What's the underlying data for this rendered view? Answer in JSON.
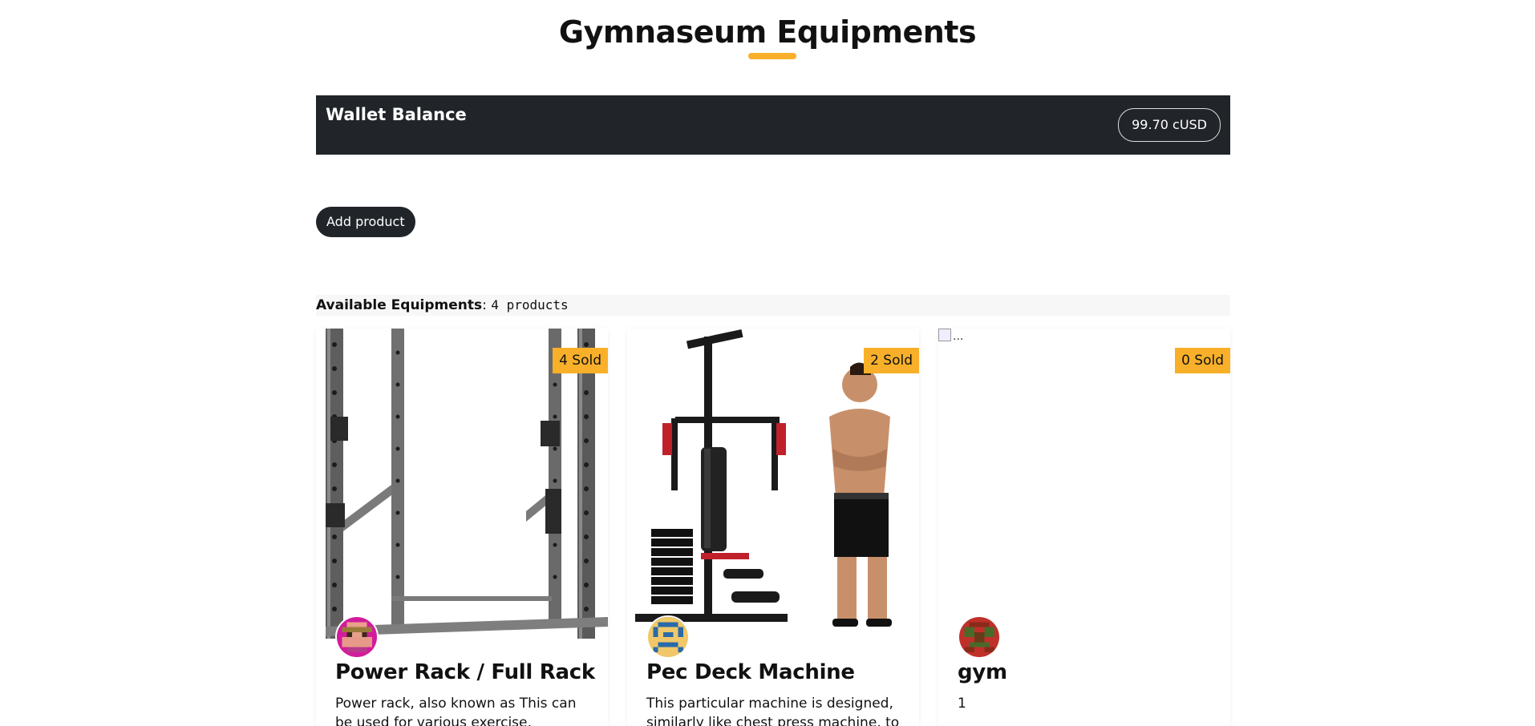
{
  "page": {
    "title": "Gymnaseum Equipments",
    "accent_color": "#f8b02a"
  },
  "wallet": {
    "label": "Wallet Balance",
    "balance": "99.70 cUSD"
  },
  "actions": {
    "add_product": "Add product"
  },
  "inventory": {
    "label": "Available Equipments",
    "separator": ":",
    "count_text": "4 products"
  },
  "products": [
    {
      "title": "Power Rack / Full Rack",
      "sold": "4 Sold",
      "description": "Power rack, also known as This can be used for various exercise, including",
      "image": "power-rack-image",
      "avatar": "identicon-magenta"
    },
    {
      "title": "Pec Deck Machine",
      "sold": "2 Sold",
      "description": "This particular machine is designed, similarly like chest press machine, to",
      "image": "home-gym-machine-image",
      "avatar": "identicon-yellow-blue"
    },
    {
      "title": "gym",
      "sold": "0 Sold",
      "description": "1",
      "image_alt": "...",
      "image": "broken-image",
      "avatar": "identicon-red-green"
    }
  ]
}
